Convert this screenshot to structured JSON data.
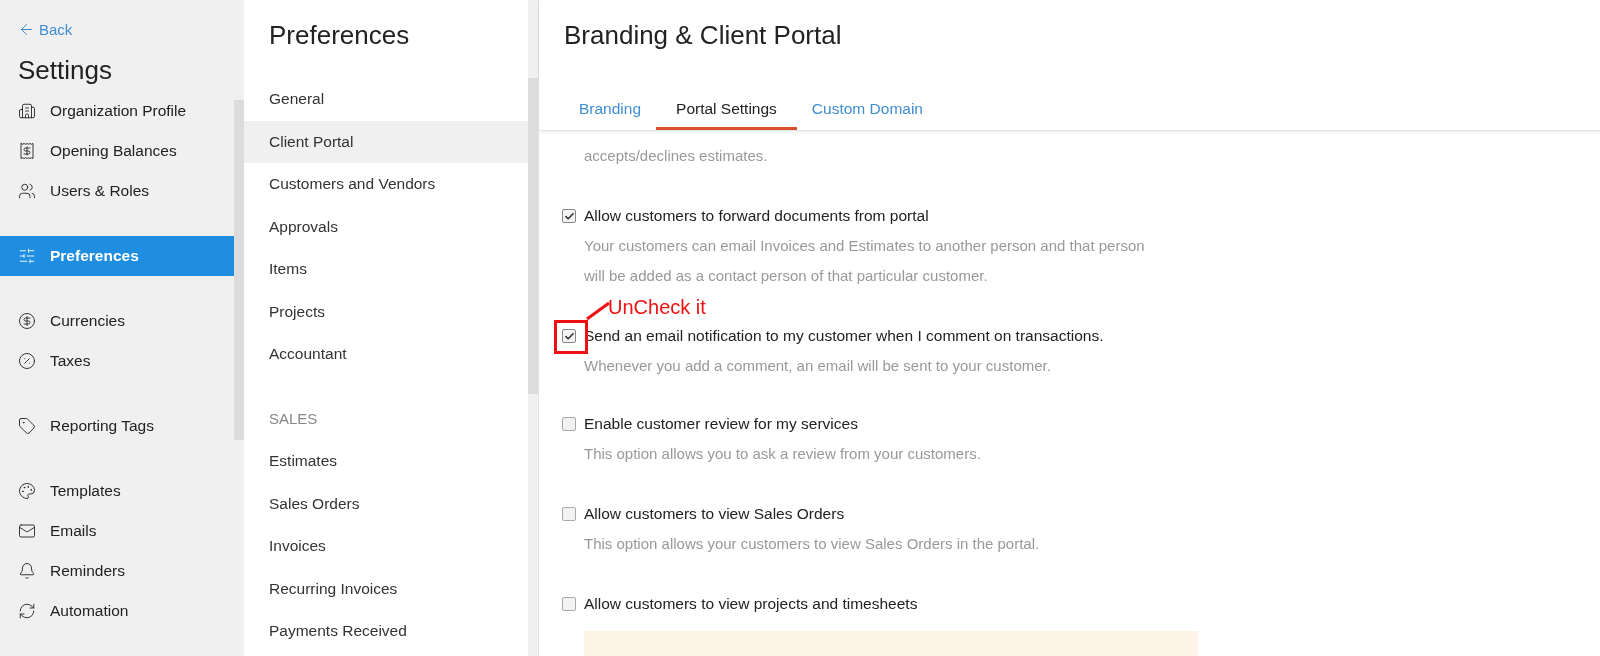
{
  "sidebar": {
    "back": "Back",
    "title": "Settings",
    "groups": [
      [
        {
          "label": "Organization Profile",
          "selected": false
        },
        {
          "label": "Opening Balances",
          "selected": false
        },
        {
          "label": "Users & Roles",
          "selected": false
        }
      ],
      [
        {
          "label": "Preferences",
          "selected": true
        }
      ],
      [
        {
          "label": "Currencies",
          "selected": false
        },
        {
          "label": "Taxes",
          "selected": false
        }
      ],
      [
        {
          "label": "Reporting Tags",
          "selected": false
        }
      ],
      [
        {
          "label": "Templates",
          "selected": false
        },
        {
          "label": "Emails",
          "selected": false
        },
        {
          "label": "Reminders",
          "selected": false
        },
        {
          "label": "Automation",
          "selected": false
        }
      ]
    ]
  },
  "preferences": {
    "title": "Preferences",
    "sections": [
      {
        "items": [
          {
            "label": "General",
            "selected": false
          },
          {
            "label": "Client Portal",
            "selected": true
          },
          {
            "label": "Customers and Vendors",
            "selected": false
          },
          {
            "label": "Approvals",
            "selected": false
          },
          {
            "label": "Items",
            "selected": false
          },
          {
            "label": "Projects",
            "selected": false
          },
          {
            "label": "Accountant",
            "selected": false
          }
        ]
      },
      {
        "heading": "SALES",
        "items": [
          {
            "label": "Estimates",
            "selected": false
          },
          {
            "label": "Sales Orders",
            "selected": false
          },
          {
            "label": "Invoices",
            "selected": false
          },
          {
            "label": "Recurring Invoices",
            "selected": false
          },
          {
            "label": "Payments Received",
            "selected": false
          }
        ]
      }
    ]
  },
  "main": {
    "title": "Branding & Client Portal",
    "tabs": [
      {
        "label": "Branding",
        "selected": false
      },
      {
        "label": "Portal Settings",
        "selected": true
      },
      {
        "label": "Custom Domain",
        "selected": false
      }
    ],
    "cut_description": "accepts/declines estimates.",
    "options": [
      {
        "label": "Allow customers to forward documents from portal",
        "checked": true,
        "description": "Your customers can email Invoices and Estimates to another person and that person will be added as a contact person of that particular customer."
      },
      {
        "label": "Send an email notification to my customer when I comment on transactions.",
        "checked": true,
        "description": "Whenever you add a comment, an email will be sent to your customer.",
        "annotation": "UnCheck it"
      },
      {
        "label": "Enable customer review for my services",
        "checked": false,
        "description": "This option allows you to ask a review from your customers."
      },
      {
        "label": "Allow customers to view Sales Orders",
        "checked": false,
        "description": "This option allows your customers to view Sales Orders in the portal."
      },
      {
        "label": "Allow customers to view projects and timesheets",
        "checked": false,
        "notice": true
      }
    ]
  }
}
